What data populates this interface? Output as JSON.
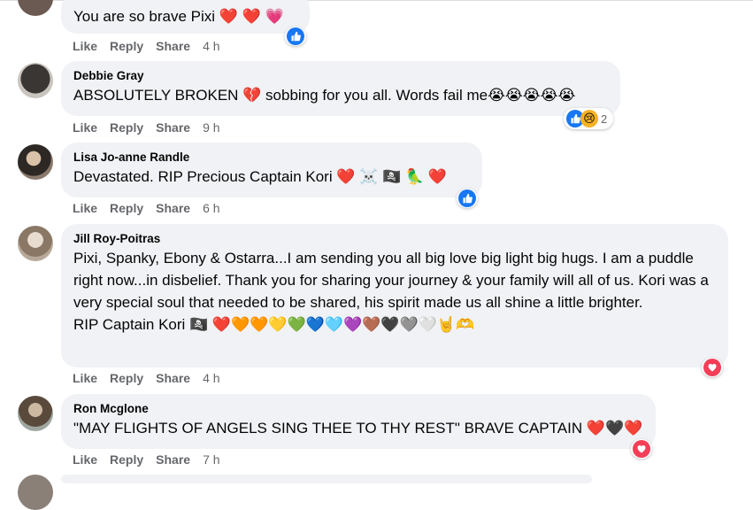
{
  "actions": {
    "like": "Like",
    "reply": "Reply",
    "share": "Share"
  },
  "comments": [
    {
      "author": "",
      "text": "You are so brave Pixi ❤️ ❤️ 💗",
      "time": "4 h",
      "reactions": [
        "like"
      ],
      "reaction_count": ""
    },
    {
      "author": "Debbie Gray",
      "text": "ABSOLUTELY BROKEN 💔 sobbing for you all. Words fail me😭😭😭😭😭",
      "time": "9 h",
      "reactions": [
        "like",
        "sad"
      ],
      "reaction_count": "2"
    },
    {
      "author": "Lisa Jo-anne Randle",
      "text": "Devastated. RIP Precious Captain Kori ❤️ ☠️ 🏴‍☠️ 🦜 ❤️",
      "time": "6 h",
      "reactions": [
        "like"
      ],
      "reaction_count": ""
    },
    {
      "author": "Jill Roy-Poitras",
      "text": "Pixi, Spanky, Ebony & Ostarra...I am sending you all big love big light big hugs. I am a puddle right now...in disbelief. Thank you for sharing your journey & your family will all of us. Kori was a very special soul that needed to be shared, his spirit made us all shine a little brighter.",
      "text2": "RIP Captain Kori 🏴‍☠️ ❤️🧡🧡💛💚💙🩵💜🤎🖤🩶🤍🤘🫶",
      "time": "4 h",
      "reactions": [
        "love"
      ],
      "reaction_count": ""
    },
    {
      "author": "Ron Mcglone",
      "text": "\"MAY FLIGHTS OF ANGELS SING THEE TO THY REST\" BRAVE CAPTAIN ❤️🖤❤️",
      "time": "7 h",
      "reactions": [
        "love"
      ],
      "reaction_count": ""
    }
  ],
  "colors": {
    "bubble": "#f0f2f5",
    "meta": "#65676b",
    "like": "#1877f2",
    "love": "#f33e58"
  }
}
